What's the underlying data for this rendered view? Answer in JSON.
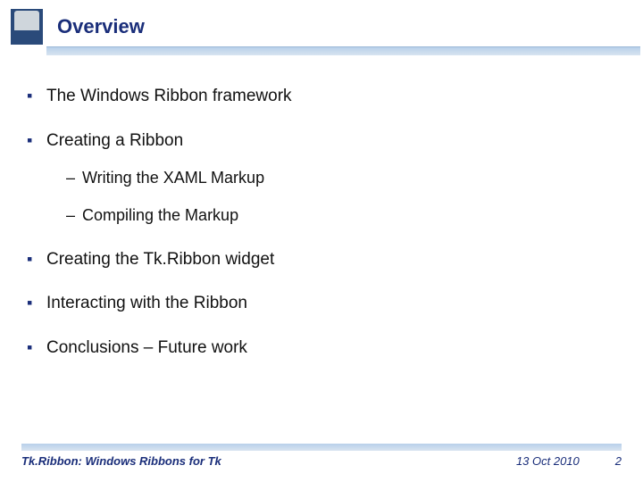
{
  "header": {
    "title": "Overview"
  },
  "bullets": {
    "b1": "The Windows Ribbon framework",
    "b2": "Creating a Ribbon",
    "b2_sub1": "Writing the XAML Markup",
    "b2_sub2": "Compiling the Markup",
    "b3": "Creating the Tk.Ribbon widget",
    "b4": "Interacting with the Ribbon",
    "b5": "Conclusions – Future work"
  },
  "footer": {
    "title": "Tk.Ribbon: Windows Ribbons for Tk",
    "date": "13 Oct 2010",
    "page": "2"
  }
}
